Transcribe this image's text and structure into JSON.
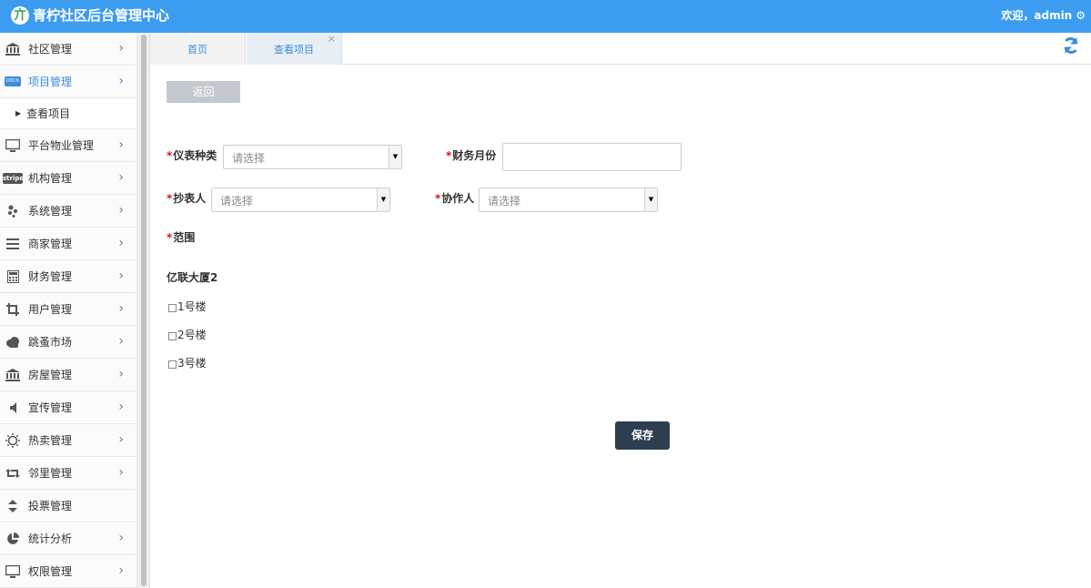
{
  "header": {
    "logo_glyph": "亣",
    "title": "青柠社区后台管理中心",
    "welcome": "欢迎，admin"
  },
  "sidebar": {
    "items": [
      {
        "label": "社区管理",
        "icon": "bank-icon"
      },
      {
        "label": "项目管理",
        "icon": "project-badge-icon",
        "active": true
      },
      {
        "label": "平台物业管理",
        "icon": "monitor-icon"
      },
      {
        "label": "机构管理",
        "icon": "stripe-icon"
      },
      {
        "label": "系统管理",
        "icon": "yelp-icon"
      },
      {
        "label": "商家管理",
        "icon": "menu-icon"
      },
      {
        "label": "财务管理",
        "icon": "calculator-icon"
      },
      {
        "label": "用户管理",
        "icon": "crop-icon"
      },
      {
        "label": "跳蚤市场",
        "icon": "cloud-icon"
      },
      {
        "label": "房屋管理",
        "icon": "bank-icon"
      },
      {
        "label": "宣传管理",
        "icon": "volume-icon"
      },
      {
        "label": "热卖管理",
        "icon": "sun-icon"
      },
      {
        "label": "邻里管理",
        "icon": "retweet-icon"
      },
      {
        "label": "投票管理",
        "icon": "sort-icon"
      },
      {
        "label": "统计分析",
        "icon": "pie-chart-icon"
      },
      {
        "label": "权限管理",
        "icon": "monitor-icon"
      }
    ],
    "sub_item": "查看项目",
    "stripe_text": "stripe",
    "badge_text": "DOCK RAD"
  },
  "tabs": [
    {
      "label": "首页"
    },
    {
      "label": "查看项目"
    }
  ],
  "content": {
    "back_label": "返回",
    "fields": {
      "meter_type": {
        "label": "仪表种类",
        "placeholder": "请选择"
      },
      "finance_month": {
        "label": "财务月份",
        "value": ""
      },
      "reader": {
        "label": "抄表人",
        "placeholder": "请选择"
      },
      "collaborator": {
        "label": "协作人",
        "placeholder": "请选择"
      },
      "scope": {
        "label": "范围"
      }
    },
    "group_title": "亿联大厦2",
    "buildings": [
      "1号楼",
      "2号楼",
      "3号楼"
    ],
    "save_label": "保存"
  },
  "colors": {
    "header_bg": "#3c9cf0",
    "accent": "#3c8ddc",
    "required": "#d9151e",
    "save_bg": "#2c3e50"
  }
}
